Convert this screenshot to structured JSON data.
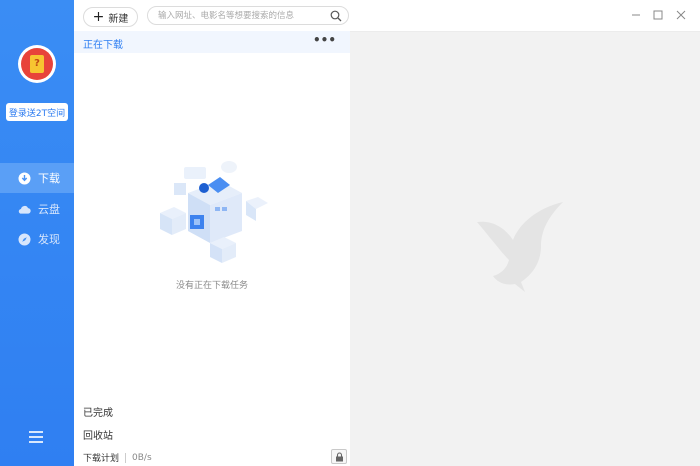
{
  "sidebar": {
    "login_label": "登录送2T空间",
    "nav": [
      {
        "label": "下载",
        "icon": "download-icon",
        "active": true
      },
      {
        "label": "云盘",
        "icon": "cloud-icon",
        "active": false
      },
      {
        "label": "发现",
        "icon": "compass-icon",
        "active": false
      }
    ],
    "menu_icon": "menu-icon"
  },
  "toolbar": {
    "new_label": "新建",
    "search_placeholder": "输入网址、电影名等想要搜索的信息"
  },
  "downloads": {
    "section_title": "正在下载",
    "more_label": "•••",
    "empty_text": "没有正在下载任务"
  },
  "bottom": {
    "completed_label": "已完成",
    "trash_label": "回收站",
    "plan_label": "下载计划",
    "speed": "0B/s"
  },
  "colors": {
    "accent": "#2f7ff2",
    "sidebar": "#3a8df4"
  }
}
